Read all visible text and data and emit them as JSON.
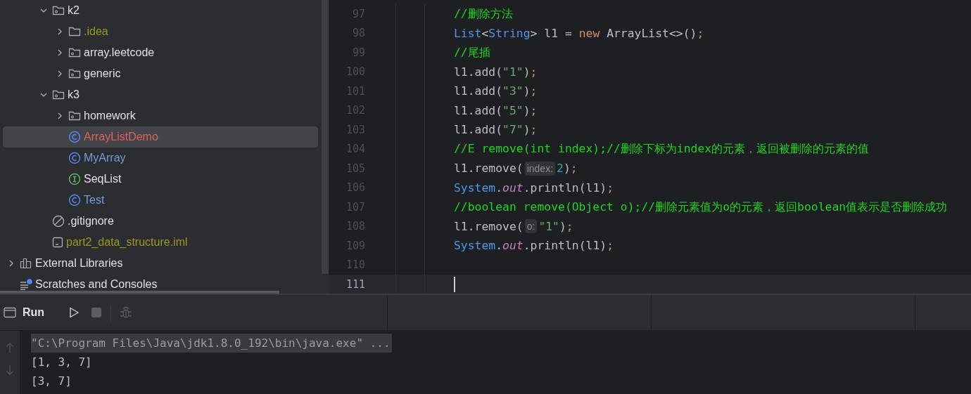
{
  "project_tree": {
    "items": [
      {
        "label": "k2",
        "kind": "package",
        "expanded": true,
        "color": "#dfe1e5",
        "selected": false,
        "children": [
          {
            "label": ".idea",
            "kind": "folder",
            "expanded": false,
            "color": "#9a9a1f",
            "selected": false
          },
          {
            "label": "array.leetcode",
            "kind": "package",
            "expanded": false,
            "color": "#dfe1e5",
            "selected": false
          },
          {
            "label": "generic",
            "kind": "package",
            "expanded": false,
            "color": "#dfe1e5",
            "selected": false
          }
        ]
      },
      {
        "label": "k3",
        "kind": "package",
        "expanded": true,
        "color": "#dfe1e5",
        "selected": false,
        "children": [
          {
            "label": "homework",
            "kind": "package",
            "expanded": false,
            "color": "#dfe1e5",
            "selected": false
          },
          {
            "label": "ArrayListDemo",
            "kind": "class",
            "color": "#e0615a",
            "selected": true
          },
          {
            "label": "MyArray",
            "kind": "class",
            "color": "#6e9fd6",
            "selected": false
          },
          {
            "label": "SeqList",
            "kind": "interface",
            "color": "#dfe1e5",
            "selected": false
          },
          {
            "label": "Test",
            "kind": "class",
            "color": "#6e9fd6",
            "selected": false
          }
        ]
      },
      {
        "label": ".gitignore",
        "kind": "ignore",
        "color": "#dfe1e5",
        "selected": false
      },
      {
        "label": "part2_data_structure.iml",
        "kind": "module",
        "color": "#9a9a1f",
        "selected": false
      }
    ],
    "root_items": [
      {
        "label": "External Libraries",
        "kind": "libraries",
        "expanded": false,
        "color": "#dfe1e5",
        "selected": false
      },
      {
        "label": "Scratches and Consoles",
        "kind": "scratches",
        "color": "#dfe1e5",
        "selected": false
      }
    ]
  },
  "editor": {
    "lines": [
      {
        "number": "97",
        "current": false,
        "tokens": [
          {
            "kind": "comment",
            "text": "//删除方法"
          }
        ]
      },
      {
        "number": "98",
        "current": false,
        "tokens": [
          {
            "kind": "type",
            "text": "List"
          },
          {
            "kind": "plain",
            "text": "<"
          },
          {
            "kind": "type",
            "text": "String"
          },
          {
            "kind": "plain",
            "text": "> l1 = "
          },
          {
            "kind": "keyword",
            "text": "new"
          },
          {
            "kind": "plain",
            "text": " ArrayList<>()"
          },
          {
            "kind": "punct",
            "text": ";"
          }
        ]
      },
      {
        "number": "99",
        "current": false,
        "tokens": [
          {
            "kind": "comment",
            "text": "//尾插"
          }
        ]
      },
      {
        "number": "100",
        "current": false,
        "tokens": [
          {
            "kind": "plain",
            "text": "l1.add("
          },
          {
            "kind": "string",
            "text": "\"1\""
          },
          {
            "kind": "plain",
            "text": ")"
          },
          {
            "kind": "punct",
            "text": ";"
          }
        ]
      },
      {
        "number": "101",
        "current": false,
        "tokens": [
          {
            "kind": "plain",
            "text": "l1.add("
          },
          {
            "kind": "string",
            "text": "\"3\""
          },
          {
            "kind": "plain",
            "text": ")"
          },
          {
            "kind": "punct",
            "text": ";"
          }
        ]
      },
      {
        "number": "102",
        "current": false,
        "tokens": [
          {
            "kind": "plain",
            "text": "l1.add("
          },
          {
            "kind": "string",
            "text": "\"5\""
          },
          {
            "kind": "plain",
            "text": ")"
          },
          {
            "kind": "punct",
            "text": ";"
          }
        ]
      },
      {
        "number": "103",
        "current": false,
        "tokens": [
          {
            "kind": "plain",
            "text": "l1.add("
          },
          {
            "kind": "string",
            "text": "\"7\""
          },
          {
            "kind": "plain",
            "text": ")"
          },
          {
            "kind": "punct",
            "text": ";"
          }
        ]
      },
      {
        "number": "104",
        "current": false,
        "tokens": [
          {
            "kind": "comment",
            "text": "//E remove(int index);//删除下标为index的元素，返回被删除的元素的值"
          }
        ]
      },
      {
        "number": "105",
        "current": false,
        "tokens": [
          {
            "kind": "plain",
            "text": "l1.remove("
          },
          {
            "kind": "hint",
            "text": "index:"
          },
          {
            "kind": "number",
            "text": "2"
          },
          {
            "kind": "plain",
            "text": ")"
          },
          {
            "kind": "punct",
            "text": ";"
          }
        ]
      },
      {
        "number": "106",
        "current": false,
        "tokens": [
          {
            "kind": "type",
            "text": "System"
          },
          {
            "kind": "plain",
            "text": "."
          },
          {
            "kind": "field",
            "text": "out"
          },
          {
            "kind": "plain",
            "text": ".println(l1)"
          },
          {
            "kind": "punct",
            "text": ";"
          }
        ]
      },
      {
        "number": "107",
        "current": false,
        "tokens": [
          {
            "kind": "comment",
            "text": "//boolean remove(Object o);//删除元素值为o的元素，返回boolean值表示是否删除成功"
          }
        ]
      },
      {
        "number": "108",
        "current": false,
        "tokens": [
          {
            "kind": "plain",
            "text": "l1.remove("
          },
          {
            "kind": "hint",
            "text": "o:"
          },
          {
            "kind": "string",
            "text": "\"1\""
          },
          {
            "kind": "plain",
            "text": ")"
          },
          {
            "kind": "punct",
            "text": ";"
          }
        ]
      },
      {
        "number": "109",
        "current": false,
        "tokens": [
          {
            "kind": "type",
            "text": "System"
          },
          {
            "kind": "plain",
            "text": "."
          },
          {
            "kind": "field",
            "text": "out"
          },
          {
            "kind": "plain",
            "text": ".println(l1)"
          },
          {
            "kind": "punct",
            "text": ";"
          }
        ]
      },
      {
        "number": "110",
        "current": false
      },
      {
        "number": "111",
        "current": true
      }
    ]
  },
  "run_panel": {
    "title": "Run",
    "buttons": [
      {
        "kind": "run",
        "disabled": false
      },
      {
        "kind": "stop",
        "disabled": true
      },
      {
        "kind": "debug",
        "disabled": true
      }
    ],
    "console": [
      {
        "kind": "command",
        "text": "\"C:\\Program Files\\Java\\jdk1.8.0_192\\bin\\java.exe\" ..."
      },
      {
        "kind": "output",
        "text": "[1, 3, 7]"
      },
      {
        "kind": "output",
        "text": "[3, 7]"
      }
    ]
  }
}
